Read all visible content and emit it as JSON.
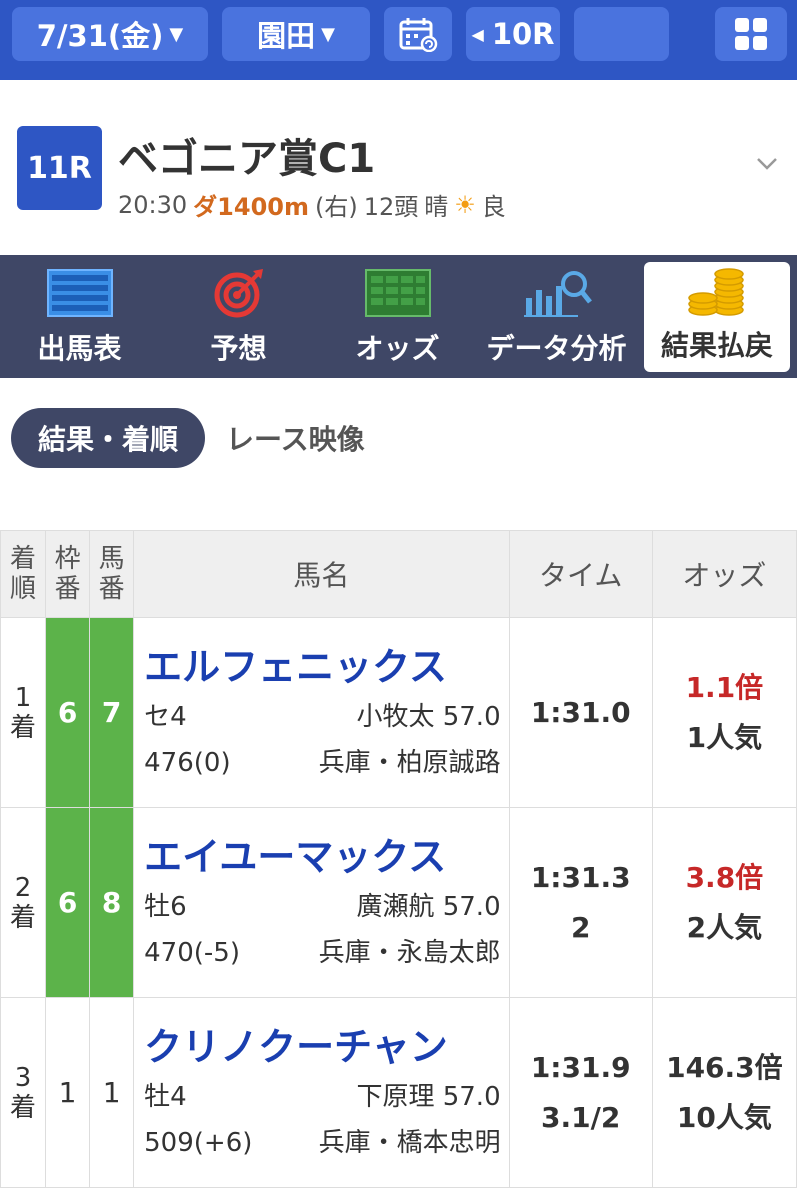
{
  "topbar": {
    "date": "7/31(金)",
    "venue": "園田",
    "calendar_icon": "calendar-icon",
    "prev_race": "10R",
    "next_race": "",
    "grid_icon": "grid-menu-icon"
  },
  "race": {
    "number": "11R",
    "title": "ベゴニア賞C1",
    "time": "20:30",
    "course": "ダ1400m",
    "direction": "(右)",
    "runners": "12頭",
    "weather": "晴",
    "weather_icon": "☀",
    "condition": "良"
  },
  "menu": [
    {
      "label": "出馬表",
      "icon": "race-card-icon"
    },
    {
      "label": "予想",
      "icon": "target-icon"
    },
    {
      "label": "オッズ",
      "icon": "odds-table-icon"
    },
    {
      "label": "データ分析",
      "icon": "chart-search-icon"
    },
    {
      "label": "結果払戻",
      "icon": "coins-icon"
    }
  ],
  "subtabs": {
    "active": "結果・着順",
    "other": "レース映像"
  },
  "table": {
    "headers": {
      "rank": "着順",
      "waku": "枠番",
      "uma": "馬番",
      "name": "馬名",
      "time": "タイム",
      "odds": "オッズ"
    },
    "rows": [
      {
        "rank": "1着",
        "waku": "6",
        "uma": "7",
        "horse": "エルフェニックス",
        "sex_age": "セ4",
        "jockey_weight": "小牧太 57.0",
        "body_weight": "476(0)",
        "trainer": "兵庫・柏原誠路",
        "time": "1:31.0",
        "margin": "",
        "odds": "1.1倍",
        "popularity": "1人気"
      },
      {
        "rank": "2着",
        "waku": "6",
        "uma": "8",
        "horse": "エイユーマックス",
        "sex_age": "牡6",
        "jockey_weight": "廣瀬航 57.0",
        "body_weight": "470(-5)",
        "trainer": "兵庫・永島太郎",
        "time": "1:31.3",
        "margin": "2",
        "odds": "3.8倍",
        "popularity": "2人気"
      },
      {
        "rank": "3着",
        "waku": "1",
        "uma": "1",
        "horse": "クリノクーチャン",
        "sex_age": "牡4",
        "jockey_weight": "下原理 57.0",
        "body_weight": "509(+6)",
        "trainer": "兵庫・橋本忠明",
        "time": "1:31.9",
        "margin": "3.1/2",
        "odds": "146.3倍",
        "popularity": "10人気"
      }
    ]
  },
  "colors": {
    "topbar": "#2e56c4",
    "menubar": "#3f4766",
    "waku_green": "#5cb34a",
    "horse_name": "#1a3fb0",
    "odds_red": "#c62828"
  }
}
